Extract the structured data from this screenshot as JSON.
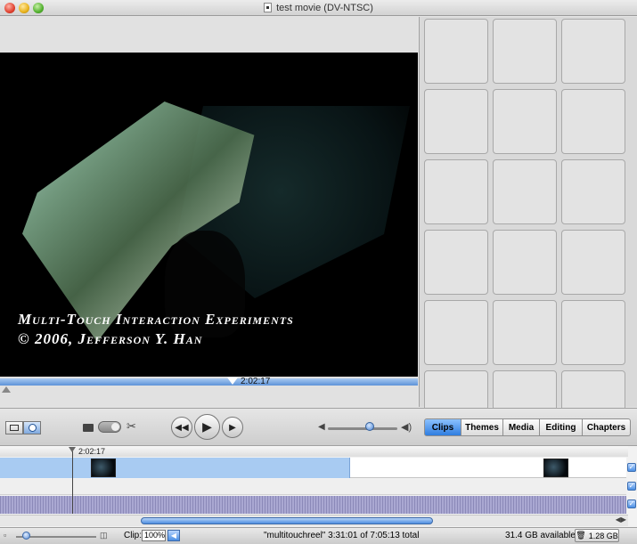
{
  "window": {
    "title": "test movie (DV-NTSC)"
  },
  "viewer": {
    "video_title": "Multi-Touch Interaction Experiments",
    "video_copyright": "© 2006, Jefferson Y. Han",
    "playhead_time": "2:02:17"
  },
  "toolbar": {
    "tabs": [
      "Clips",
      "Themes",
      "Media",
      "Editing",
      "Chapters"
    ],
    "active_tab": "Clips",
    "volume_level": 0.55
  },
  "timeline": {
    "playhead_time": "2:02:17"
  },
  "status": {
    "clip_label": "Clip:",
    "clip_volume": "100%",
    "summary": "\"multitouchreel\"  3:31:01 of 7:05:13 total",
    "available": "31.4 GB available",
    "trash_size": "1.28 GB"
  },
  "icons": [
    "doc-icon",
    "camera-icon",
    "scissors-icon",
    "rewind-icon",
    "play-icon",
    "fast-forward-icon",
    "volume-low-icon",
    "volume-high-icon",
    "trash-icon"
  ],
  "colors": {
    "accent": "#2f7de0",
    "selection": "#a8cbf2"
  }
}
